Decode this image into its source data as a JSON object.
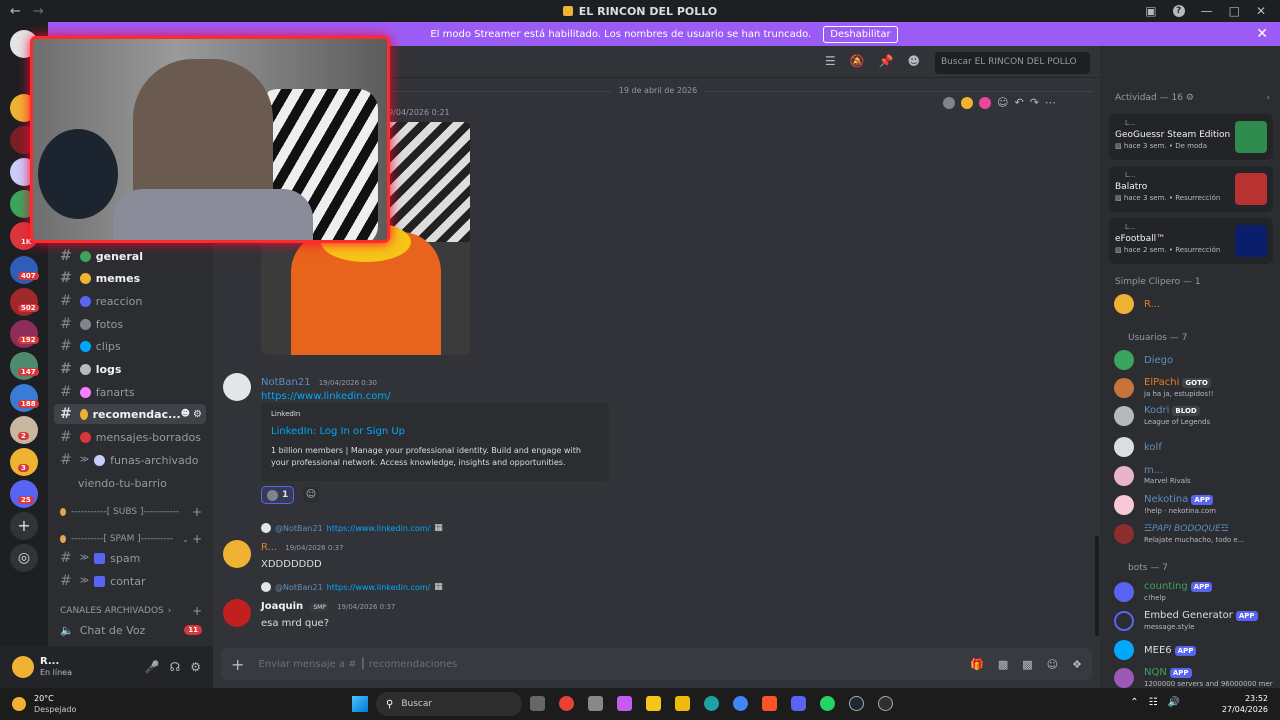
{
  "window": {
    "title": "EL RINCON DEL POLLO"
  },
  "banner": {
    "text": "El modo Streamer está habilitado. Los nombres de usuario se han truncado.",
    "button": "Deshabilitar"
  },
  "server_badges": [
    "407",
    "502",
    "192",
    "147",
    "188",
    "2",
    "3",
    "25"
  ],
  "server_top_badge": "1K",
  "channels": [
    {
      "name": "general",
      "emoji_color": "#3ba55d",
      "bold": true
    },
    {
      "name": "memes",
      "emoji_color": "#f0b232",
      "bold": true
    },
    {
      "name": "reaccion",
      "emoji_color": "#5865f2",
      "bold": false
    },
    {
      "name": "fotos",
      "emoji_color": "#80848e",
      "bold": false
    },
    {
      "name": "clips",
      "emoji_color": "#00a8fc",
      "bold": false
    },
    {
      "name": "logs",
      "emoji_color": "#b5bac1",
      "bold": true
    },
    {
      "name": "fanarts",
      "emoji_color": "#f47fff",
      "bold": false
    },
    {
      "name": "recomendac...",
      "emoji_color": "#f0b232",
      "bold": true,
      "active": true
    },
    {
      "name": "mensajes-borrados",
      "emoji_color": "#da373c",
      "bold": false
    },
    {
      "name": "funas-archivado",
      "emoji_color": "#c9cdfb",
      "bold": false
    },
    {
      "name": "viendo-tu-barrio",
      "emoji_color": "",
      "bold": false
    },
    {
      "name": "spam",
      "emoji_color": "#5865f2",
      "bold": false
    },
    {
      "name": "contar",
      "emoji_color": "#5865f2",
      "bold": false
    }
  ],
  "categories": {
    "subs": "-----------[ SUBS ]-----------",
    "spam": "----------[ SPAM ]----------",
    "archived": "CANALES ARCHIVADOS",
    "voice": "Chat de Voz",
    "voice_badge": "11"
  },
  "user": {
    "name": "R...",
    "status": "En línea"
  },
  "search_placeholder": "Buscar EL RINCON DEL POLLO",
  "date_divider": "19 de abril de 2026",
  "messages": {
    "first_time": "19/04/2026 0:21",
    "m1": {
      "author": "NotBan21",
      "time": "19/04/2026 0:30",
      "link": "https://www.linkedin.com/",
      "embed_site": "LinkedIn",
      "embed_title": "LinkedIn: Log In or Sign Up",
      "embed_desc": "1 billion members | Manage your professional identity. Build and engage with your professional network. Access knowledge, insights and opportunities.",
      "reaction_count": "1"
    },
    "m2": {
      "reply_author": "@NotBan21",
      "reply_text": "https://www.linkedin.com/",
      "author": "R...",
      "time": "19/04/2026 0:37",
      "text": "XDDDDDDD"
    },
    "m3": {
      "reply_author": "@NotBan21",
      "reply_text": "https://www.linkedin.com/",
      "author": "Joaquin",
      "tag": "SMP",
      "time": "19/04/2026 0:37",
      "text": "esa mrd que?"
    }
  },
  "composer_placeholder": "Enviar mensaje a # ┃ recomendaciones",
  "members": {
    "activity_header": "Actividad — 16",
    "activities": [
      {
        "user": "L...",
        "game": "GeoGuessr Steam Edition",
        "time": "hace 3 sem.",
        "extra": "De moda"
      },
      {
        "user": "L...",
        "game": "Balatro",
        "time": "hace 3 sem.",
        "extra": "Resurrección"
      },
      {
        "user": "L...",
        "game": "eFootball™",
        "time": "hace 2 sem.",
        "extra": "Resurrección"
      }
    ],
    "group1": "Simple Clipero — 1",
    "group1_member": "R...",
    "group2": "Usuarios — 7",
    "users": [
      {
        "name": "Diego",
        "sub": "",
        "tag": ""
      },
      {
        "name": "ElPachi",
        "sub": "ja ha ja, estupidos!!",
        "tag": "GOTO"
      },
      {
        "name": "Kodri",
        "sub": "League of Legends",
        "tag": "BLOD"
      },
      {
        "name": "kolf",
        "sub": "",
        "tag": ""
      },
      {
        "name": "m...",
        "sub": "Marvel Rivals",
        "tag": ""
      },
      {
        "name": "Nekotina",
        "sub": "!help · nekotina.com",
        "tag": "APP"
      },
      {
        "name": "☲PAPI BODOQUE☲",
        "sub": "Relajate muchacho, todo e...",
        "tag": ""
      }
    ],
    "group3": "bots — 7",
    "bots": [
      {
        "name": "counting",
        "sub": "c!help",
        "tag": "APP"
      },
      {
        "name": "Embed Generator",
        "sub": "message.style",
        "tag": "APP"
      },
      {
        "name": "MEE6",
        "sub": "",
        "tag": "APP"
      },
      {
        "name": "NQN",
        "sub": "1200000 servers and 96000000 mer",
        "tag": "APP"
      }
    ]
  },
  "taskbar": {
    "weather_temp": "20°C",
    "weather_desc": "Despejado",
    "search": "Buscar",
    "time": "23:52",
    "date": "27/04/2026"
  }
}
